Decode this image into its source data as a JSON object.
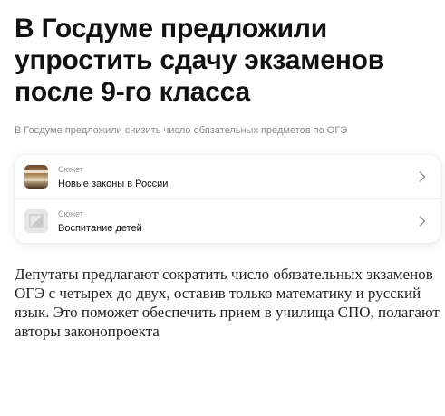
{
  "article": {
    "headline": "В Госдуме предложили упростить сдачу экзаменов после 9-го класса",
    "subtitle": "В Госдуме предложили снизить число обязательных предметов по ОГЭ",
    "lead": "Депутаты предлагают сократить число обязательных экзаменов ОГЭ с четырех до двух, оставив только математику и русский язык. Это поможет обеспечить прием в училища СПО, полагают авторы законопроекта"
  },
  "plots": [
    {
      "kicker": "Сюжет",
      "title": "Новые законы в России",
      "thumb_icon": "photo-thumbnail"
    },
    {
      "kicker": "Сюжет",
      "title": "Воспитание детей",
      "thumb_icon": "image-placeholder-icon"
    }
  ],
  "colors": {
    "headline": "#111111",
    "subtitle": "#8a8a8a",
    "kicker": "#9a9a9a",
    "chevron": "#8c8c8c"
  }
}
